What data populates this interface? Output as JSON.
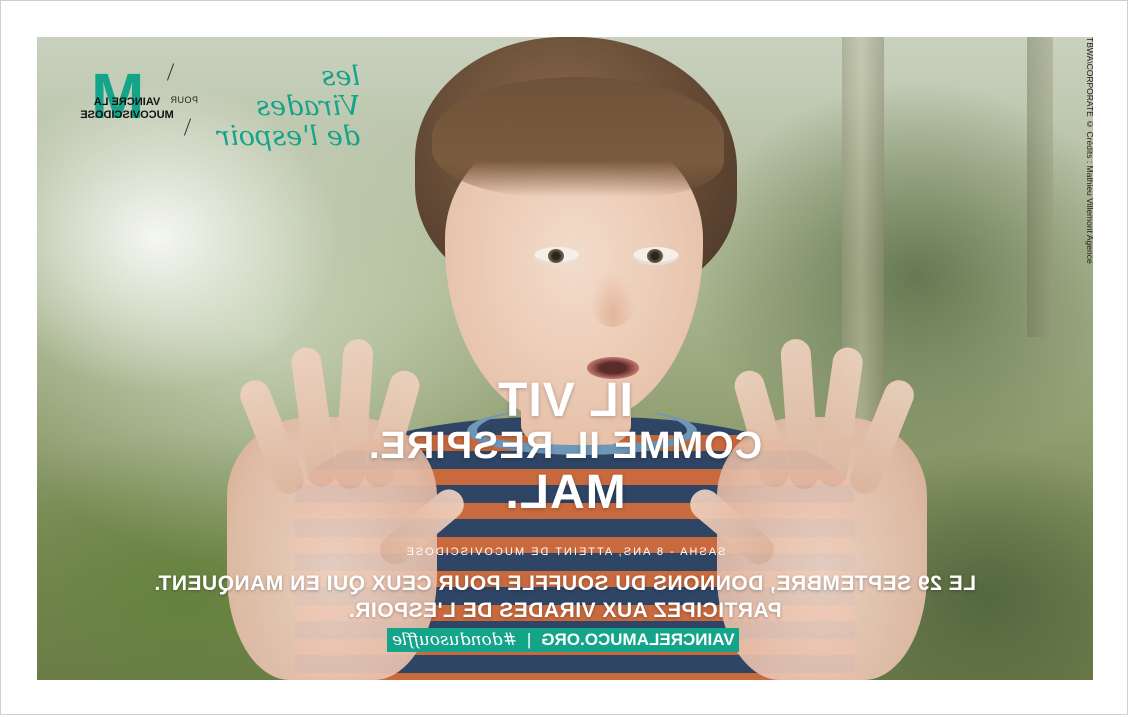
{
  "brand": {
    "vaincre_line1": "VAINCRE LA",
    "vaincre_line2": "MUCOVISCIDOSE",
    "pour": "POUR",
    "virades_line1": "les Virades",
    "virades_line2": "de l'espoir",
    "accent_color": "#14a48a"
  },
  "credit": "TBWA\\CORPORATE © Crédits : Mathieu Villemont Agence",
  "headline": {
    "line1": "IL VIT",
    "line2": "COMME IL RESPIRE.",
    "line3": "MAL."
  },
  "caption": "SASHA - 8 ANS, ATTEINT DE MUCOVISCIDOSE",
  "body": {
    "line1": "LE 29 SEPTEMBRE, DONNONS DU SOUFFLE POUR CEUX QUI EN MANQUENT.",
    "line2": "PARTICIPEZ AUX VIRADES DE L'ESPOIR."
  },
  "cta": {
    "url": "VAINCRELAMUCO.ORG",
    "separator": "|",
    "hashtag": "#dondusouffle"
  },
  "image_note_mirrored": true
}
